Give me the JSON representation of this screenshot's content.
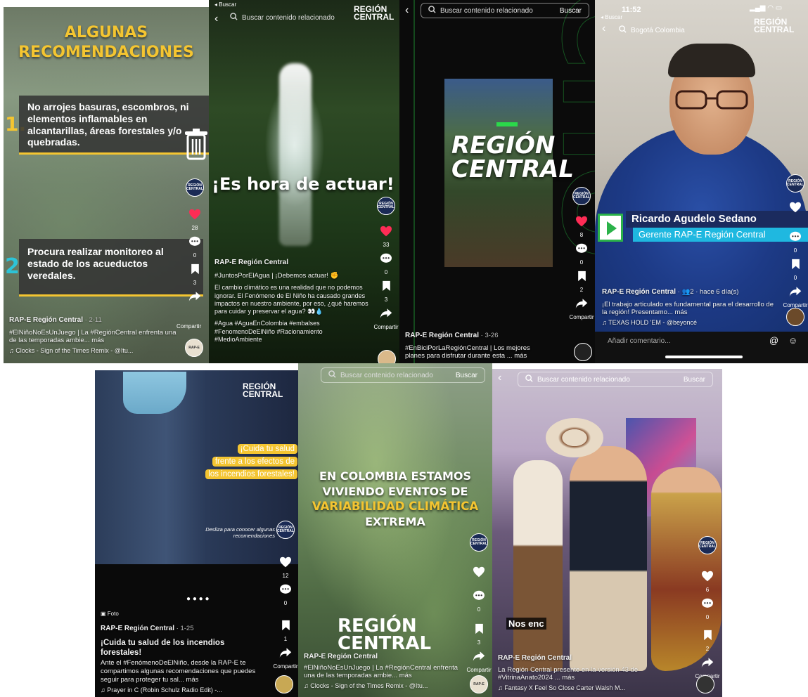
{
  "colors": {
    "yellow": "#f4c531",
    "cyan": "#1fd7f5",
    "like_red": "#fe2c55",
    "green_neon": "#2bd94a",
    "navy": "#1b2b5e"
  },
  "p1": {
    "title_line1": "ALGUNAS",
    "title_line2": "RECOMENDACIONES",
    "num1": "1.",
    "tip1": "No arrojes basuras, escombros, ni elementos inflamables en alcantarillas, áreas forestales y/o quebradas.",
    "num2": "2",
    "tip2": "Procura realizar monitoreo al estado de los acueductos veredales.",
    "likes": "28",
    "comments": "0",
    "saves": "3",
    "share": "Compartir",
    "user": "RAP-E Región Central",
    "date": "· 2-11",
    "desc": "#ElNiñoNoEsUnJuego | La #RegiónCentral enfrenta una de las temporadas ambie... más",
    "music": "♫ Clocks - Sign of the Times Remix - @Itu..."
  },
  "p2": {
    "status": "◂ Buscar",
    "search": "Buscar contenido relacionado",
    "logo1": "REGIÓN",
    "logo2": "CENTRAL",
    "headline": "¡Es hora de actuar!",
    "likes": "33",
    "comments": "0",
    "saves": "3",
    "share": "Compartir",
    "user": "RAP-E Región Central",
    "tags1": "#JuntosPorElAgua | ¡Debemos actuar! ✊",
    "body": "El cambio climático es una realidad que no podemos ignorar. El Fenómeno de El Niño ha causado grandes impactos en nuestro ambiente, por eso, ¿qué haremos para cuidar y preservar el agua? 👀💧",
    "tags2": "#Agua #AguaEnColombia #embalses #FenomenoDeElNiño #Racionamiento #MedioAmbiente"
  },
  "p3": {
    "search": "Buscar contenido relacionado",
    "search_btn": "Buscar",
    "logo1": "REGIÓN",
    "logo2": "CENTRAL",
    "likes": "8",
    "comments": "0",
    "saves": "2",
    "share": "Compartir",
    "user": "RAP-E Región Central",
    "date": "· 3-26",
    "desc": "#EnBiciPorLaRegiónCentral | Los mejores planes para disfrutar durante esta ... más"
  },
  "p4": {
    "time": "11:52",
    "status": "◂ Buscar",
    "location": "Bogotá Colombia",
    "logo1": "REGIÓN",
    "logo2": "CENTRAL",
    "name": "Ricardo Agudelo Sedano",
    "role": "Gerente RAP-E Región Central",
    "likes": "",
    "comments": "0",
    "saves": "0",
    "share": "Compartir",
    "user": "RAP-E Región Central",
    "meta": "· 👥2 · hace 6 día(s)",
    "desc": "¡El trabajo articulado es fundamental para el desarrollo de la región! Presentamo... más",
    "music": "♫ TEXAS HOLD 'EM - @beyoncé",
    "comment_placeholder": "Añadir comentario..."
  },
  "p5": {
    "logo1": "REGIÓN",
    "logo2": "CENTRAL",
    "banner1": "¡Cuida tu salud",
    "banner2": "frente a los efectos de",
    "banner3": "los incendios forestales!",
    "swipe": "Desliza para conocer algunas recomendaciones",
    "likes": "12",
    "comments": "0",
    "saves": "1",
    "share": "Compartir",
    "photo_label": "Foto",
    "user": "RAP-E Región Central",
    "date": "· 1-25",
    "title": "¡Cuida tu salud de los incendios forestales!",
    "desc": "Ante el #FenómenoDeElNiño, desde la RAP-E te compartimos algunas recomendaciones que puedes seguir para proteger tu sal... más",
    "music": "♫ Prayer in C (Robin Schulz Radio Edit) -..."
  },
  "p6": {
    "search": "Buscar contenido relacionado",
    "search_btn": "Buscar",
    "line1": "EN COLOMBIA ESTAMOS",
    "line2": "VIVIENDO EVENTOS DE",
    "line3": "VARIABILIDAD CLIMÁTICA",
    "line4": "EXTREMA",
    "logo1": "REGIÓN",
    "logo2": "CENTRAL",
    "likes": "",
    "comments": "0",
    "saves": "3",
    "share": "Compartir",
    "user": "RAP-E Región Central",
    "desc": "#ElNiñoNoEsUnJuego | La #RegiónCentral enfrenta una de las temporadas ambie... más",
    "music": "♫ Clocks - Sign of the Times Remix - @Itu..."
  },
  "p7": {
    "search": "Buscar contenido relacionado",
    "search_btn": "Buscar",
    "overlay": "Nos enc",
    "likes": "6",
    "comments": "0",
    "saves": "2",
    "share": "Compartir",
    "user": "RAP-E Región Central",
    "desc": "La Región Central presente en la versión 43 de #VitrinaAnato2024 ... más",
    "music": "♫ Fantasy X Feel So Close Carter Walsh M..."
  }
}
